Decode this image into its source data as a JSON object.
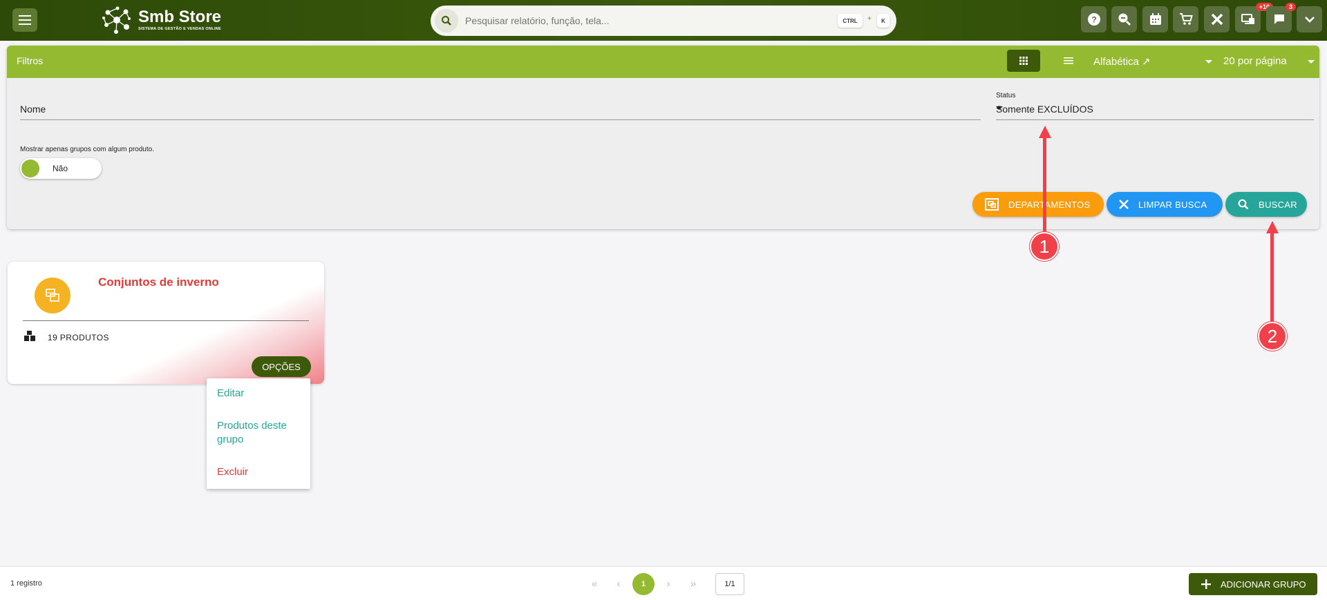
{
  "header": {
    "logo_title": "Smb Store",
    "logo_subtitle": "SISTEMA DE GESTÃO E VENDAS ONLINE",
    "search_placeholder": "Pesquisar relatório, função, tela...",
    "shortcut_key1": "CTRL",
    "shortcut_plus": "+",
    "shortcut_key2": "K",
    "icons": [
      "help-icon",
      "zoom-search-icon",
      "calendar-icon",
      "cart-icon",
      "tools-icon",
      "screens-icon",
      "chat-icon",
      "chevron-down-icon"
    ],
    "badge_screens": "+10",
    "badge_chat": "3"
  },
  "filters": {
    "title": "Filtros",
    "sort_label": "Alfabética ↗",
    "per_page_label": "20 por página",
    "nome_label": "Nome",
    "status_label": "Status",
    "status_value": "Somente EXCLUÍDOS",
    "toggle_label": "Mostrar apenas grupos com algum produto.",
    "toggle_value": "Não",
    "btn_departamentos": "DEPARTAMENTOS",
    "btn_limpar": "LIMPAR BUSCA",
    "btn_buscar": "BUSCAR",
    "colors": {
      "header_green": "#94ba32",
      "orange": "#fb9c0c",
      "blue": "#2196f3",
      "teal": "#26a69a"
    }
  },
  "card": {
    "title": "Conjuntos de inverno",
    "products": "19 PRODUTOS",
    "options_label": "OPÇÕES"
  },
  "dropdown": {
    "edit": "Editar",
    "products": "Produtos deste grupo",
    "delete": "Excluir"
  },
  "annotations": {
    "marker1": "1",
    "marker2": "2"
  },
  "footer": {
    "records": "1 registro",
    "current_page": "1",
    "page_total": "1/1",
    "add_button": "ADICIONAR GRUPO",
    "pager_icons": [
      "first-page-icon",
      "prev-page-icon",
      "next-page-icon",
      "last-page-icon"
    ]
  }
}
